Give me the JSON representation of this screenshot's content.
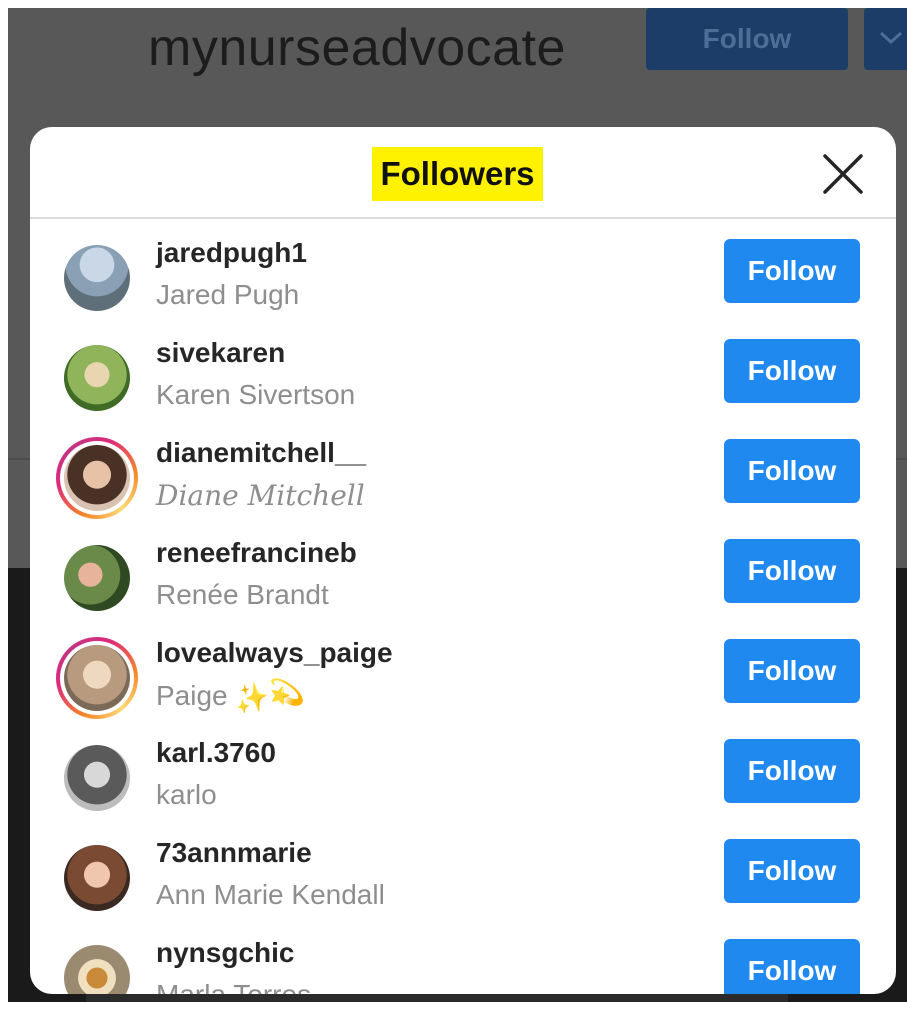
{
  "background": {
    "profile_username": "mynurseadvocate",
    "follow_button_label": "Follow",
    "dropdown_icon": "chevron-down-icon"
  },
  "modal": {
    "title": "Followers",
    "title_highlight_color": "#fff200",
    "close_icon": "close-icon",
    "follow_button_color": "#2089f0",
    "followers": [
      {
        "username": "jaredpugh1",
        "full_name": "Jared Pugh",
        "button": "Follow",
        "story_ring": false
      },
      {
        "username": "sivekaren",
        "full_name": "Karen Sivertson",
        "button": "Follow",
        "story_ring": false
      },
      {
        "username": "dianemitchell__",
        "full_name": "Diane Mitchell",
        "button": "Follow",
        "story_ring": true
      },
      {
        "username": "reneefrancineb",
        "full_name": "Renée Brandt",
        "button": "Follow",
        "story_ring": false
      },
      {
        "username": "lovealways_paige",
        "full_name": "Paige",
        "full_name_suffix": "✨💫",
        "button": "Follow",
        "story_ring": true
      },
      {
        "username": "karl.3760",
        "full_name": "karlo",
        "button": "Follow",
        "story_ring": false
      },
      {
        "username": "73annmarie",
        "full_name": "Ann Marie Kendall",
        "button": "Follow",
        "story_ring": false
      },
      {
        "username": "nynsgchic",
        "full_name": "Marla Torres",
        "button": "Follow",
        "story_ring": false
      }
    ]
  }
}
